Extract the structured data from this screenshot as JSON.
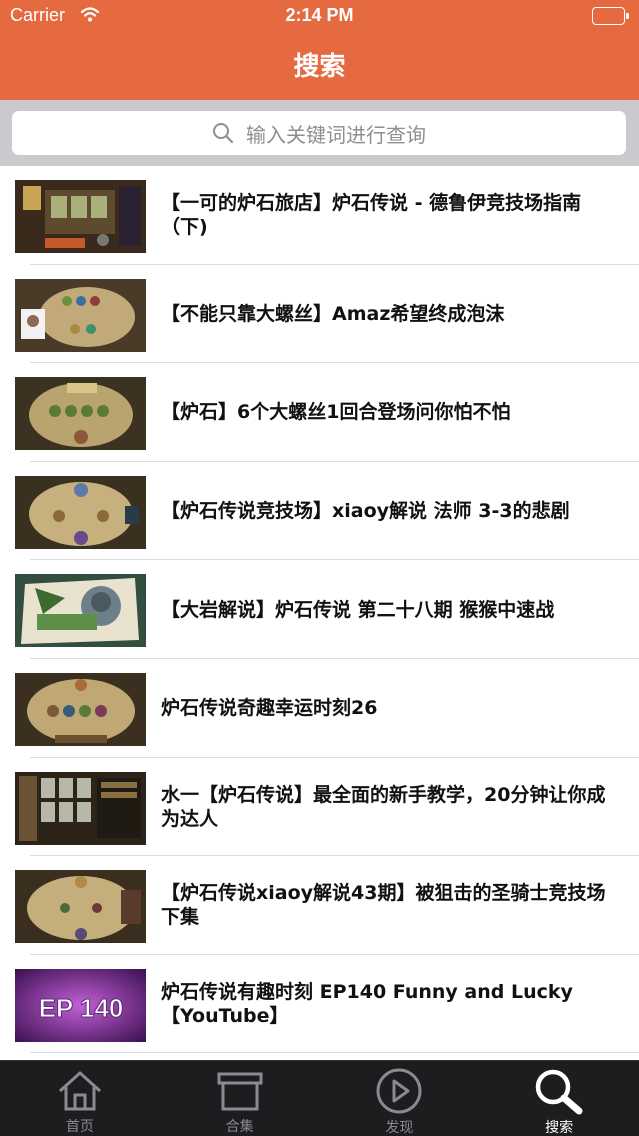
{
  "status_bar": {
    "carrier": "Carrier",
    "time": "2:14 PM"
  },
  "nav": {
    "title": "搜索"
  },
  "search": {
    "placeholder": "输入关键词进行查询"
  },
  "videos": [
    {
      "title": "【一可的炉石旅店】炉石传说 - 德鲁伊竞技场指南（下)"
    },
    {
      "title": "【不能只靠大螺丝】Amaz希望终成泡沫"
    },
    {
      "title": "【炉石】6个大螺丝1回合登场问你怕不怕"
    },
    {
      "title": "【炉石传说竞技场】xiaoy解说 法师 3-3的悲剧"
    },
    {
      "title": "【大岩解说】炉石传说 第二十八期 猴猴中速战"
    },
    {
      "title": "炉石传说奇趣幸运时刻26"
    },
    {
      "title": "水一【炉石传说】最全面的新手教学，20分钟让你成为达人"
    },
    {
      "title": "【炉石传说xiaoy解说43期】被狙击的圣骑士竞技场下集"
    },
    {
      "title": "炉石传说有趣时刻 EP140 Funny and Lucky【YouTube】",
      "thumb_text": "EP 140"
    }
  ],
  "tabs": [
    {
      "label": "首页",
      "icon": "home-icon"
    },
    {
      "label": "合集",
      "icon": "box-icon"
    },
    {
      "label": "发现",
      "icon": "play-circle-icon"
    },
    {
      "label": "搜索",
      "icon": "search-icon",
      "active": true
    }
  ],
  "colors": {
    "accent": "#e56a40",
    "tabbar": "#1d1d20",
    "search_bg": "#c9c9ce"
  }
}
